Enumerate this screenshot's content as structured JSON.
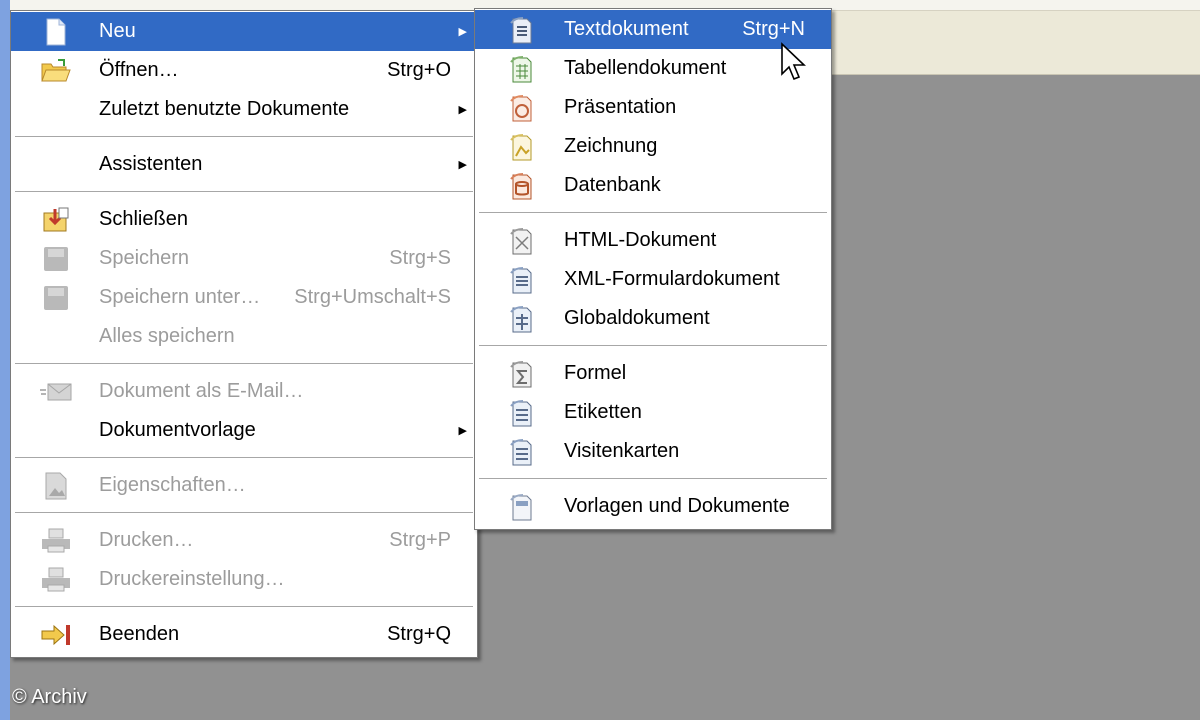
{
  "menus": {
    "file": {
      "items": [
        {
          "label": "Neu",
          "shortcut": "",
          "icon": "new-document-icon",
          "submenu": true,
          "enabled": true,
          "highlighted": true
        },
        {
          "label": "Öffnen…",
          "shortcut": "Strg+O",
          "icon": "open-folder-icon",
          "submenu": false,
          "enabled": true
        },
        {
          "label": "Zuletzt benutzte Dokumente",
          "shortcut": "",
          "icon": "",
          "submenu": true,
          "enabled": true
        },
        {
          "label": "Assistenten",
          "shortcut": "",
          "icon": "",
          "submenu": true,
          "enabled": true
        },
        {
          "label": "Schließen",
          "shortcut": "",
          "icon": "close-document-icon",
          "submenu": false,
          "enabled": true
        },
        {
          "label": "Speichern",
          "shortcut": "Strg+S",
          "icon": "save-icon",
          "submenu": false,
          "enabled": false
        },
        {
          "label": "Speichern unter…",
          "shortcut": "Strg+Umschalt+S",
          "icon": "save-as-icon",
          "submenu": false,
          "enabled": false
        },
        {
          "label": "Alles speichern",
          "shortcut": "",
          "icon": "",
          "submenu": false,
          "enabled": false
        },
        {
          "label": "Dokument als E-Mail…",
          "shortcut": "",
          "icon": "email-icon",
          "submenu": false,
          "enabled": false
        },
        {
          "label": "Dokumentvorlage",
          "shortcut": "",
          "icon": "",
          "submenu": true,
          "enabled": true
        },
        {
          "label": "Eigenschaften…",
          "shortcut": "",
          "icon": "properties-icon",
          "submenu": false,
          "enabled": false
        },
        {
          "label": "Drucken…",
          "shortcut": "Strg+P",
          "icon": "printer-icon",
          "submenu": false,
          "enabled": false
        },
        {
          "label": "Druckereinstellung…",
          "shortcut": "",
          "icon": "printer-settings-icon",
          "submenu": false,
          "enabled": false
        },
        {
          "label": "Beenden",
          "shortcut": "Strg+Q",
          "icon": "exit-icon",
          "submenu": false,
          "enabled": true
        }
      ]
    },
    "new": {
      "items": [
        {
          "label": "Textdokument",
          "shortcut": "Strg+N",
          "icon": "text-document-icon",
          "highlighted": true
        },
        {
          "label": "Tabellendokument",
          "shortcut": "",
          "icon": "spreadsheet-icon"
        },
        {
          "label": "Präsentation",
          "shortcut": "",
          "icon": "presentation-icon"
        },
        {
          "label": "Zeichnung",
          "shortcut": "",
          "icon": "drawing-icon"
        },
        {
          "label": "Datenbank",
          "shortcut": "",
          "icon": "database-icon"
        },
        {
          "label": "HTML-Dokument",
          "shortcut": "",
          "icon": "html-document-icon"
        },
        {
          "label": "XML-Formulardokument",
          "shortcut": "",
          "icon": "xml-form-icon"
        },
        {
          "label": "Globaldokument",
          "shortcut": "",
          "icon": "master-document-icon"
        },
        {
          "label": "Formel",
          "shortcut": "",
          "icon": "formula-icon"
        },
        {
          "label": "Etiketten",
          "shortcut": "",
          "icon": "labels-icon"
        },
        {
          "label": "Visitenkarten",
          "shortcut": "",
          "icon": "business-cards-icon"
        },
        {
          "label": "Vorlagen und Dokumente",
          "shortcut": "",
          "icon": "templates-icon"
        }
      ]
    }
  },
  "footer": {
    "copyright": "© Archiv"
  },
  "colors": {
    "highlight": "#316ac5",
    "disabled": "#9c9c9c",
    "desktop": "#919191"
  }
}
